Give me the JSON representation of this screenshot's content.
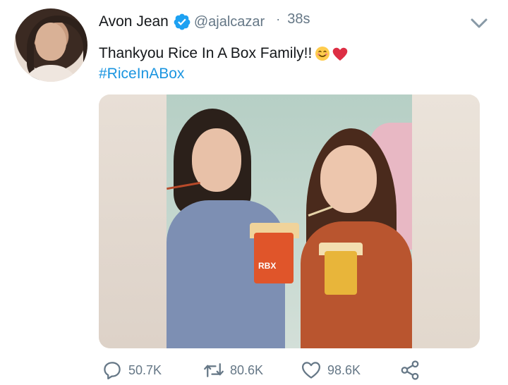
{
  "tweet": {
    "author_name": "Avon Jean",
    "handle": "@ajalcazar",
    "separator": "·",
    "time": "38s",
    "text": "Thankyou Rice In A Box Family!!",
    "hashtag": "#RiceInABox",
    "media_box_text": "RBX"
  },
  "actions": {
    "replies": "50.7K",
    "retweets": "80.6K",
    "likes": "98.6K"
  },
  "colors": {
    "link": "#1b95e0",
    "secondary": "#657786",
    "verified": "#1da1f2"
  },
  "icons": [
    "verified-badge-icon",
    "chevron-down-icon",
    "smile-emoji-icon",
    "red-heart-emoji-icon",
    "reply-icon",
    "retweet-icon",
    "like-icon",
    "share-icon"
  ]
}
